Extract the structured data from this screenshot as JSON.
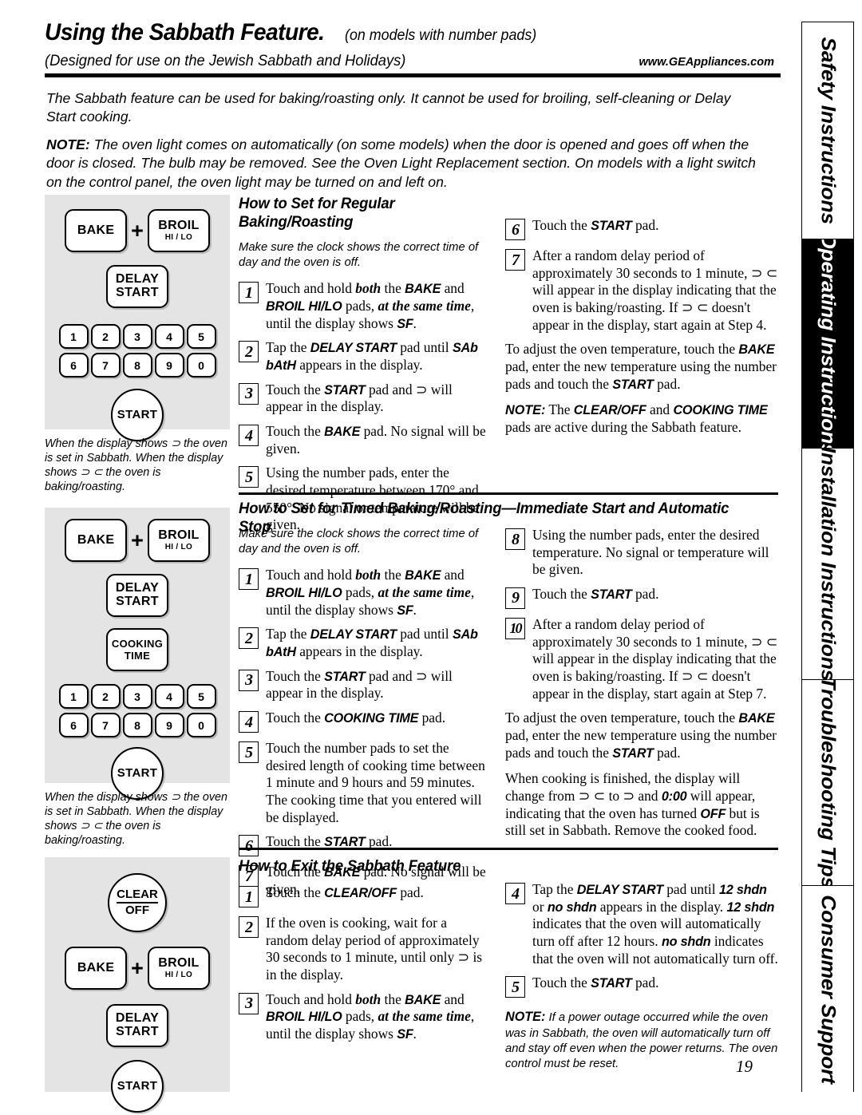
{
  "header": {
    "title": "Using the Sabbath Feature.",
    "title_sub": "(on models with number pads)",
    "designed": "(Designed for use on the Jewish Sabbath and Holidays)",
    "url": "www.GEAppliances.com"
  },
  "intro": {
    "p1": "The Sabbath feature can be used for baking/roasting only. It cannot be used for broiling, self-cleaning or Delay Start cooking.",
    "note_label": "NOTE:",
    "note_text": "The oven light comes on automatically (on some models) when the door is opened and goes off when the door is closed. The bulb may be removed. See the Oven Light Replacement section. On models with a light switch on the control panel, the oven light may be turned on and left on."
  },
  "panel_caption": "When the display shows ⊃ the oven is set in Sabbath. When the display shows ⊃ ⊂ the oven is baking/roasting.",
  "keys": {
    "bake": "BAKE",
    "broil": "BROIL",
    "broil_sub": "HI / LO",
    "delay": "DELAY",
    "delay2": "START",
    "cooking": "COOKING",
    "cooking2": "TIME",
    "start": "START",
    "clear": "CLEAR",
    "off": "OFF",
    "plus": "+",
    "numbers_row1": [
      "1",
      "2",
      "3",
      "4",
      "5"
    ],
    "numbers_row2": [
      "6",
      "7",
      "8",
      "9",
      "0"
    ]
  },
  "section1": {
    "title": "How to Set for Regular Baking/Roasting",
    "intro": "Make sure the clock shows the correct time of day and the oven is off.",
    "steps_left": [
      {
        "n": "1",
        "text": "Touch and hold both the BAKE and BROIL HI/LO pads, at the same time, until the display shows SF."
      },
      {
        "n": "2",
        "text": "Tap the DELAY START pad until SAb bAtH appears in the display."
      },
      {
        "n": "3",
        "text": "Touch the START pad and ⊃ will appear in the display."
      },
      {
        "n": "4",
        "text": "Touch the BAKE pad. No signal will be given."
      },
      {
        "n": "5",
        "text": "Using the number pads, enter the desired temperature between 170° and 550°. No signal or temperature will be given."
      }
    ],
    "steps_right": [
      {
        "n": "6",
        "text": "Touch the START pad."
      },
      {
        "n": "7",
        "text": "After a random delay period of approximately 30 seconds to 1 minute, ⊃ ⊂ will appear in the display indicating that the oven is baking/roasting. If ⊃ ⊂ doesn't appear in the display, start again at Step 4."
      }
    ],
    "adjust": "To adjust the oven temperature, touch the BAKE pad, enter the new temperature using the number pads and touch the START pad.",
    "note_label": "NOTE:",
    "note": "The CLEAR/OFF and COOKING TIME pads are active during the Sabbath feature."
  },
  "section2": {
    "title": "How to Set for Timed Baking/Roasting—Immediate Start and Automatic Stop",
    "intro": "Make sure the clock shows the correct time of day and the oven is off.",
    "steps_left": [
      {
        "n": "1",
        "text": "Touch and hold both the BAKE and BROIL HI/LO pads, at the same time, until the display shows SF."
      },
      {
        "n": "2",
        "text": "Tap the DELAY START pad until SAb bAtH appears in the display."
      },
      {
        "n": "3",
        "text": "Touch the START pad and ⊃ will appear in the display."
      },
      {
        "n": "4",
        "text": "Touch the COOKING TIME pad."
      },
      {
        "n": "5",
        "text": "Touch the number pads to set the desired length of cooking time between 1 minute and 9 hours and 59 minutes. The cooking time that you entered will be displayed."
      },
      {
        "n": "6",
        "text": "Touch the START pad."
      },
      {
        "n": "7",
        "text": "Touch the BAKE pad. No signal will be given."
      }
    ],
    "steps_right": [
      {
        "n": "8",
        "text": "Using the number pads, enter the desired temperature. No signal or temperature will be given."
      },
      {
        "n": "9",
        "text": "Touch the START pad."
      },
      {
        "n": "10",
        "text": "After a random delay period of approximately 30 seconds to 1 minute, ⊃ ⊂ will appear in the display indicating that the oven is baking/roasting. If ⊃ ⊂ doesn't appear in the display, start again at Step 7."
      }
    ],
    "adjust": "To adjust the oven temperature, touch the BAKE pad, enter the new temperature using the number pads and touch the START pad.",
    "finished": "When cooking is finished, the display will change from ⊃ ⊂ to ⊃ and 0:00 will appear, indicating that the oven has turned OFF but is still set in Sabbath. Remove the cooked food."
  },
  "section3": {
    "title": "How to Exit the Sabbath Feature",
    "steps_left": [
      {
        "n": "1",
        "text": "Touch the CLEAR/OFF pad."
      },
      {
        "n": "2",
        "text": "If the oven is cooking, wait for a random delay period of approximately 30 seconds to 1 minute, until only ⊃ is in the display."
      },
      {
        "n": "3",
        "text": "Touch and hold both the BAKE and BROIL HI/LO pads, at the same time, until the display shows SF."
      }
    ],
    "steps_right": [
      {
        "n": "4",
        "text": "Tap the DELAY START pad until 12 shdn or no shdn appears in the display. 12 shdn indicates that the oven will automatically turn off after 12 hours. no shdn indicates that the oven will not automatically turn off."
      },
      {
        "n": "5",
        "text": "Touch the START pad."
      }
    ],
    "note_label": "NOTE:",
    "note": "If a power outage occurred while the oven was in Sabbath, the oven will automatically turn off and stay off even when the power returns. The oven control must be reset."
  },
  "rail": {
    "tabs": [
      {
        "label": "Safety Instructions",
        "active": false
      },
      {
        "label": "Operating Instructions",
        "active": true
      },
      {
        "label": "Installation Instructions",
        "active": false
      },
      {
        "label": "Troubleshooting Tips",
        "active": false
      },
      {
        "label": "Consumer Support",
        "active": false
      }
    ]
  },
  "page_number": "19"
}
